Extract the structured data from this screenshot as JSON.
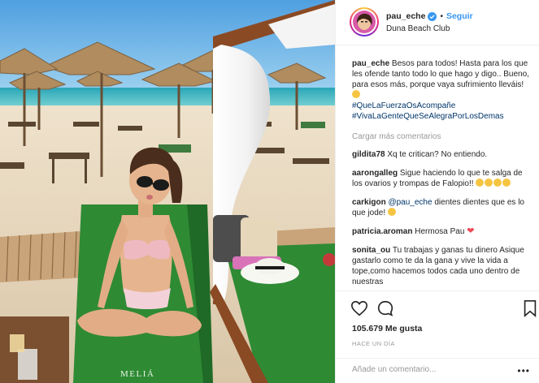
{
  "post": {
    "username": "pau_eche",
    "follow_label": "Seguir",
    "separator": "•",
    "location": "Duna Beach Club"
  },
  "caption": {
    "username": "pau_eche",
    "text": "Besos para todos! Hasta para los que les ofende tanto todo lo que hago y digo.. Bueno, para esos más, porque vaya sufrimiento lleváis!",
    "hashtags": [
      "#QueLaFuerzaOsAcompañe",
      "#VivaLaGenteQueSeAlegraPorLosDemas"
    ]
  },
  "load_more": "Cargar más comentarios",
  "comments": [
    {
      "username": "gildita78",
      "text": "Xq te critican? No entiendo."
    },
    {
      "username": "aarongalleg",
      "text": "Sigue haciendo lo que te salga de los ovarios y trompas de Falopio!!"
    },
    {
      "username": "carkigon",
      "mention": "@pau_eche",
      "text": "dientes dientes que es lo que jode!"
    },
    {
      "username": "patricia.aroman",
      "text": "Hermosa Pau"
    },
    {
      "username": "sonita_ou",
      "text": "Tu trabajas y ganas tu dinero Asique gastarlo como te da la gana y vive la vida a tope,como hacemos todos cada uno dentro de nuestras"
    }
  ],
  "likes": "105.679 Me gusta",
  "time_ago": "HACE UN DÍA",
  "add_comment_placeholder": "Añade un comentario...",
  "more_options": "•••",
  "photo": {
    "towel_brand": "MELIÁ"
  },
  "icons": [
    "heart-icon",
    "comment-icon",
    "bookmark-icon",
    "verified-badge-icon"
  ],
  "colors": {
    "accent": "#3897f0",
    "hashtag": "#003569",
    "heart": "#ed4956",
    "muted": "#999999"
  }
}
